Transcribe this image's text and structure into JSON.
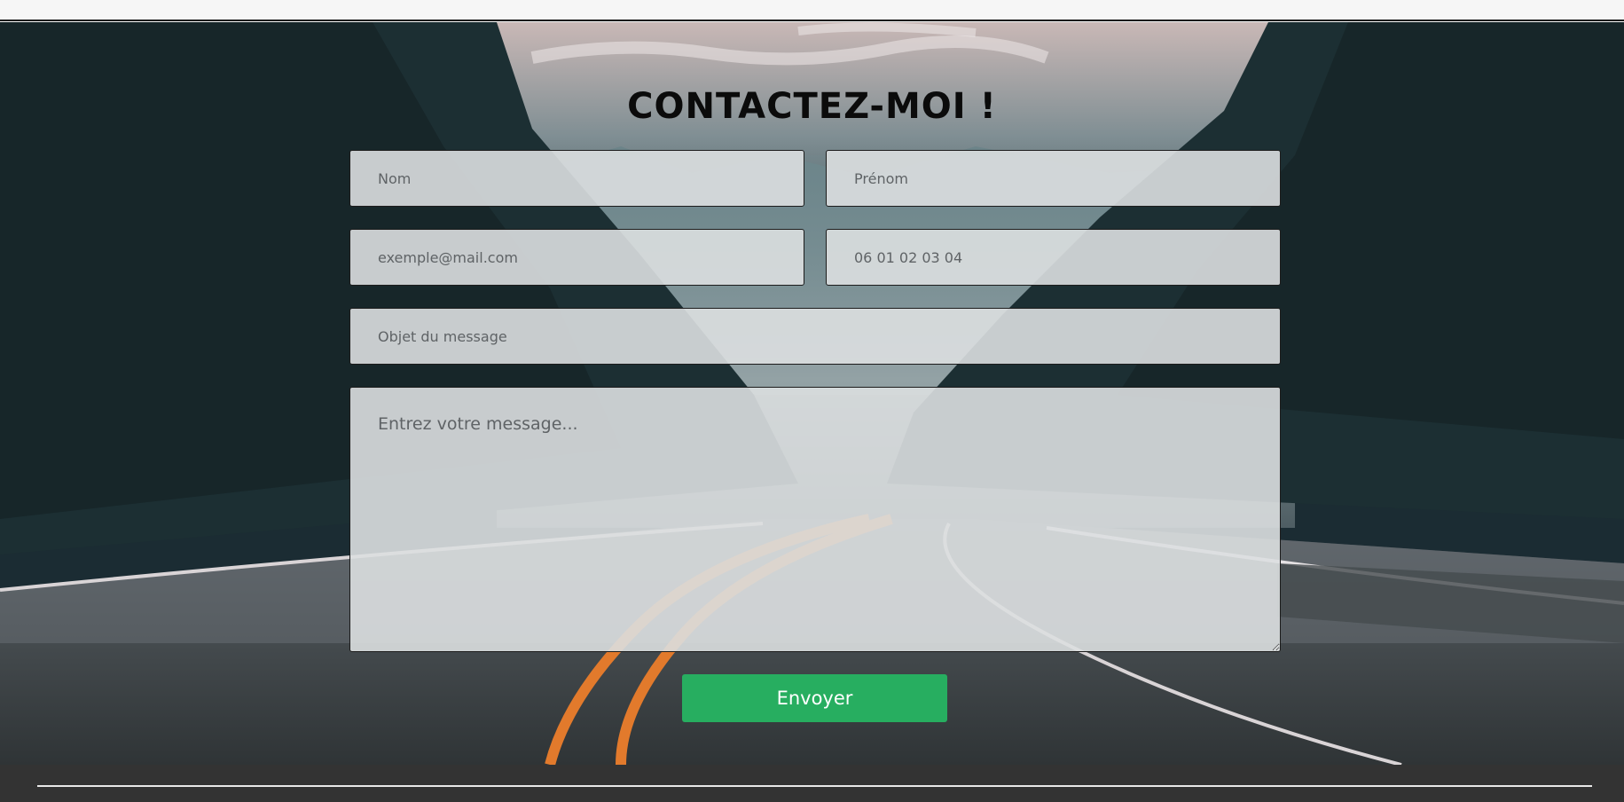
{
  "page": {
    "title": "CONTACTEZ-MOI !"
  },
  "form": {
    "nom_placeholder": "Nom",
    "prenom_placeholder": "Prénom",
    "email_placeholder": "exemple@mail.com",
    "phone_placeholder": "06 01 02 03 04",
    "subject_placeholder": "Objet du message",
    "message_placeholder": "Entrez votre message...",
    "submit_label": "Envoyer"
  },
  "colors": {
    "accent": "#27ae60",
    "footer": "#333333",
    "field_bg": "#dcdfe0"
  }
}
